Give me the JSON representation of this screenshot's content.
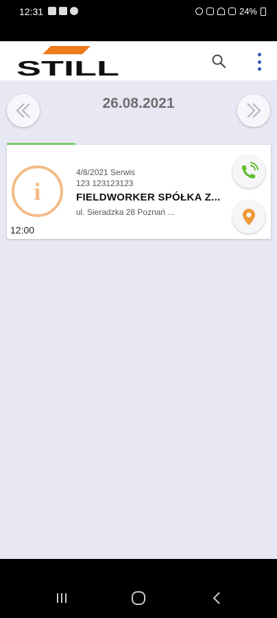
{
  "status_bar": {
    "time": "12:31",
    "battery": "24%"
  },
  "app": {
    "logo_text": "STILL",
    "brand_color": "#ee7a1e"
  },
  "date_nav": {
    "date": "26.08.2021",
    "progress": 0.26
  },
  "task_card": {
    "icon": "info-icon",
    "time": "12:00",
    "line1": "4/8/2021 Serwis",
    "line2": "123 123123123",
    "title": "FIELDWORKER SPÓŁKA Z...",
    "address": "ul. Sieradzka 28  Poznań ...",
    "accent_color": "#f3bb86",
    "phone_color": "#5fbf2e",
    "map_color": "#ef9a3a"
  }
}
